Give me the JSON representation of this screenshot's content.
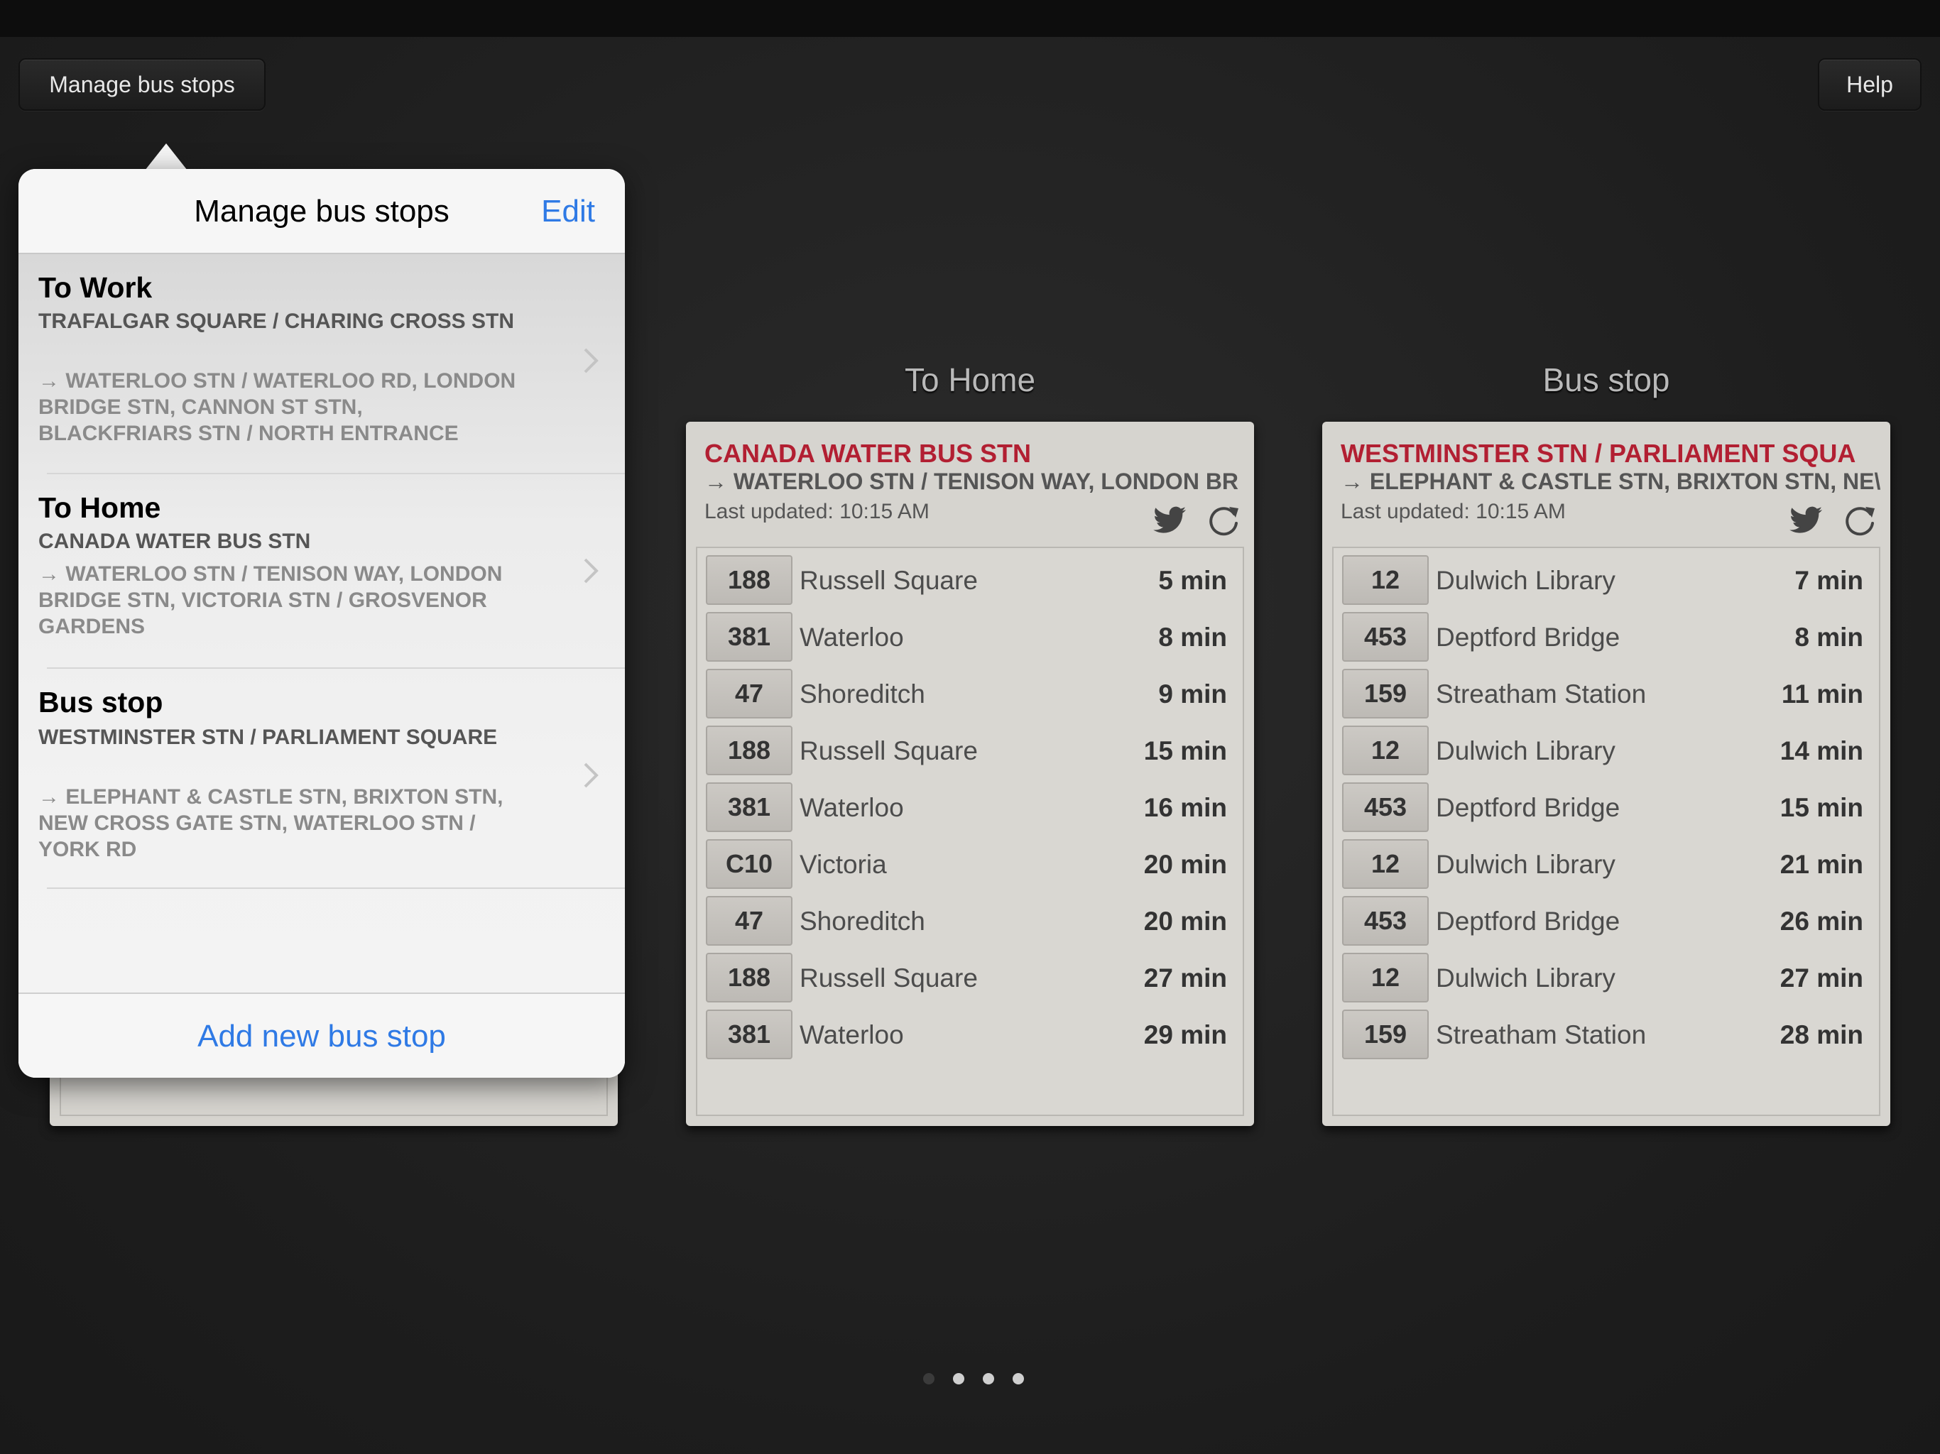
{
  "toolbar": {
    "manage_label": "Manage bus stops",
    "help_label": "Help"
  },
  "popover": {
    "title": "Manage bus stops",
    "edit_label": "Edit",
    "add_label": "Add new bus stop",
    "items": [
      {
        "name": "To Work",
        "station": "TRAFALGAR SQUARE / CHARING CROSS STN",
        "destinations": "→ WATERLOO STN / WATERLOO RD, LONDON BRIDGE STN, CANNON ST STN, BLACKFRIARS STN / NORTH ENTRANCE"
      },
      {
        "name": "To Home",
        "station": "CANADA WATER BUS STN",
        "destinations": "→ WATERLOO STN / TENISON WAY, LONDON BRIDGE STN, VICTORIA STN / GROSVENOR GARDENS"
      },
      {
        "name": "Bus stop",
        "station": "WESTMINSTER STN / PARLIAMENT SQUARE",
        "destinations": "→ ELEPHANT & CASTLE STN, BRIXTON STN, NEW CROSS GATE STN, WATERLOO STN / YORK RD"
      }
    ]
  },
  "cards": [
    {
      "title": "To Home",
      "stop": "CANADA WATER BUS STN",
      "destinations": "→ WATERLOO STN / TENISON WAY, LONDON BR",
      "updated": "Last updated: 10:15 AM",
      "departures": [
        {
          "route": "188",
          "dest": "Russell Square",
          "time": "5 min"
        },
        {
          "route": "381",
          "dest": "Waterloo",
          "time": "8 min"
        },
        {
          "route": "47",
          "dest": "Shoreditch",
          "time": "9 min"
        },
        {
          "route": "188",
          "dest": "Russell Square",
          "time": "15 min"
        },
        {
          "route": "381",
          "dest": "Waterloo",
          "time": "16 min"
        },
        {
          "route": "C10",
          "dest": "Victoria",
          "time": "20 min"
        },
        {
          "route": "47",
          "dest": "Shoreditch",
          "time": "20 min"
        },
        {
          "route": "188",
          "dest": "Russell Square",
          "time": "27 min"
        },
        {
          "route": "381",
          "dest": "Waterloo",
          "time": "29 min"
        }
      ]
    },
    {
      "title": "Bus stop",
      "stop": "WESTMINSTER STN / PARLIAMENT SQUA",
      "destinations": "→ ELEPHANT & CASTLE STN, BRIXTON STN, NE\\",
      "updated": "Last updated: 10:15 AM",
      "departures": [
        {
          "route": "12",
          "dest": "Dulwich Library",
          "time": "7 min"
        },
        {
          "route": "453",
          "dest": "Deptford Bridge",
          "time": "8 min"
        },
        {
          "route": "159",
          "dest": "Streatham Station",
          "time": "11 min"
        },
        {
          "route": "12",
          "dest": "Dulwich Library",
          "time": "14 min"
        },
        {
          "route": "453",
          "dest": "Deptford Bridge",
          "time": "15 min"
        },
        {
          "route": "12",
          "dest": "Dulwich Library",
          "time": "21 min"
        },
        {
          "route": "453",
          "dest": "Deptford Bridge",
          "time": "26 min"
        },
        {
          "route": "12",
          "dest": "Dulwich Library",
          "time": "27 min"
        },
        {
          "route": "159",
          "dest": "Streatham Station",
          "time": "28 min"
        }
      ]
    }
  ],
  "colors": {
    "accent": "#2f7ae5",
    "stop_name": "#b21f32"
  },
  "page_indicator": {
    "count": 4,
    "active_index": 0
  }
}
